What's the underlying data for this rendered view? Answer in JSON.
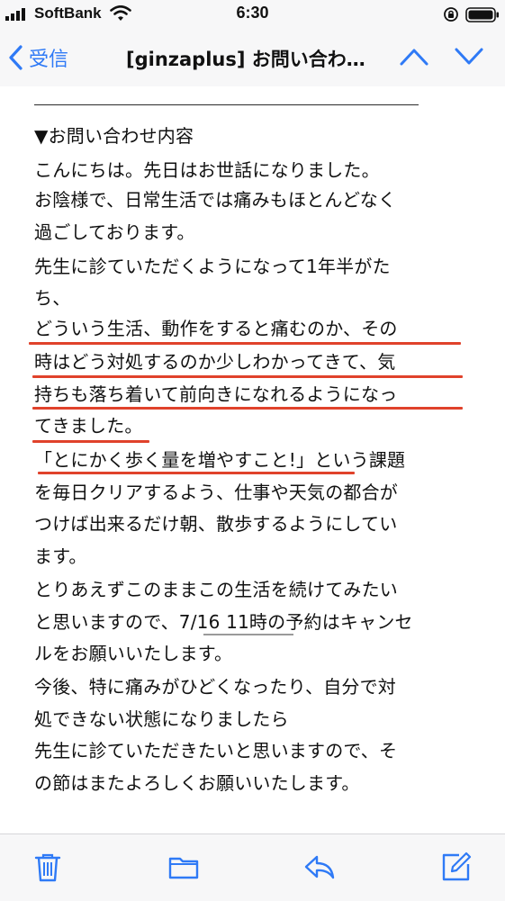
{
  "status_bar": {
    "carrier": "SoftBank",
    "time": "6:30"
  },
  "nav": {
    "back_label": "受信",
    "title": "[ginzaplus] お問い合わ…"
  },
  "mail": {
    "lines": [
      "▼お問い合わせ内容",
      "こんにちは。先日はお世話になりました。",
      "お陰様で、日常生活では痛みもほとんどなく",
      "過ごしております。",
      "先生に診ていただくようになって1年半がた",
      "ち、",
      "どういう生活、動作をすると痛むのか、その",
      "時はどう対処するのか少しわかってきて、気",
      "持ちも落ち着いて前向きになれるようになっ",
      "てきました。",
      "「とにかく歩く量を増やすこと!」という課題",
      "を毎日クリアするよう、仕事や天気の都合が",
      "つけば出来るだけ朝、散歩するようにしてい",
      "ます。",
      "とりあえずこのままこの生活を続けてみたい",
      "と思いますので、7/16 11時の予約はキャンセ",
      "ルをお願いいたします。",
      "今後、特に痛みがひどくなったり、自分で対",
      "処できない状態になりましたら",
      "先生に診ていただきたいと思いますので、そ",
      "の節はまたよろしくお願いいたします。"
    ]
  },
  "colors": {
    "accent": "#2f7af6",
    "highlight_underline": "#e0422b"
  },
  "icons": {
    "signal": "cellular-signal-icon",
    "wifi": "wifi-icon",
    "rotation_lock": "rotation-lock-icon",
    "battery": "battery-icon",
    "back": "chevron-left-icon",
    "up": "chevron-up-icon",
    "down": "chevron-down-icon",
    "trash": "trash-icon",
    "folder": "folder-icon",
    "reply": "reply-icon",
    "compose": "compose-icon"
  }
}
